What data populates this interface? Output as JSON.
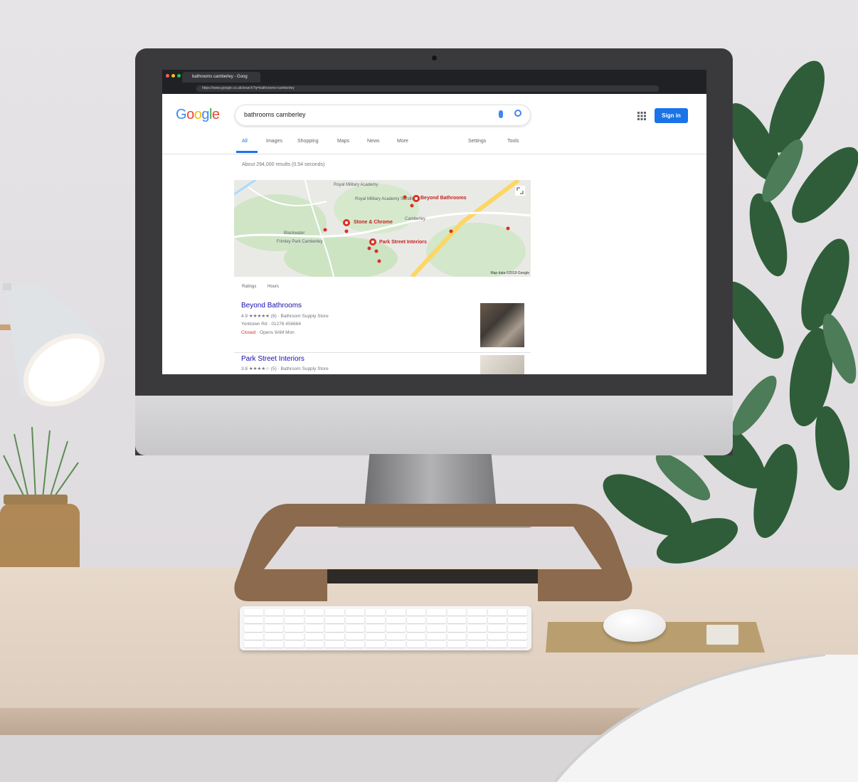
{
  "browser": {
    "tab_title": "bathrooms camberley - Goog",
    "url": "https://www.google.co.uk/search?q=bathrooms+camberley"
  },
  "google": {
    "logo_letters": [
      "G",
      "o",
      "o",
      "g",
      "l",
      "e"
    ],
    "logo_colors": [
      "#4285f4",
      "#ea4335",
      "#fbbc05",
      "#4285f4",
      "#34a853",
      "#ea4335"
    ],
    "query": "bathrooms camberley",
    "sign_in_label": "Sign in",
    "tabs": [
      "All",
      "Images",
      "Shopping",
      "Maps",
      "News",
      "More"
    ],
    "active_tab": "All",
    "right_tabs": [
      "Settings",
      "Tools"
    ],
    "result_stats": "About 294,000 results (0.54 seconds)"
  },
  "map": {
    "labels": [
      "Royal Military Academy",
      "Royal Military Academy Sandhurst",
      "Camberley",
      "Blackwater",
      "Frimley Park Camberley"
    ],
    "businesses": [
      "Beyond Bathrooms",
      "Stone & Chrome",
      "Park Street Interiors"
    ],
    "credit": "Map data ©2019 Google"
  },
  "filters": [
    "Ratings",
    "Hours"
  ],
  "listings": [
    {
      "title": "Beyond Bathrooms",
      "rating_line": "4.9 ★★★★★ (8) · Bathroom Supply Store",
      "address_line": "Yorktown Rd · 01276 456664",
      "status": "Closed",
      "hours": " · Opens 9AM Mon"
    },
    {
      "title": "Park Street Interiors",
      "rating_line": "3.8 ★★★★☆ (5) · Bathroom Supply Store"
    }
  ]
}
